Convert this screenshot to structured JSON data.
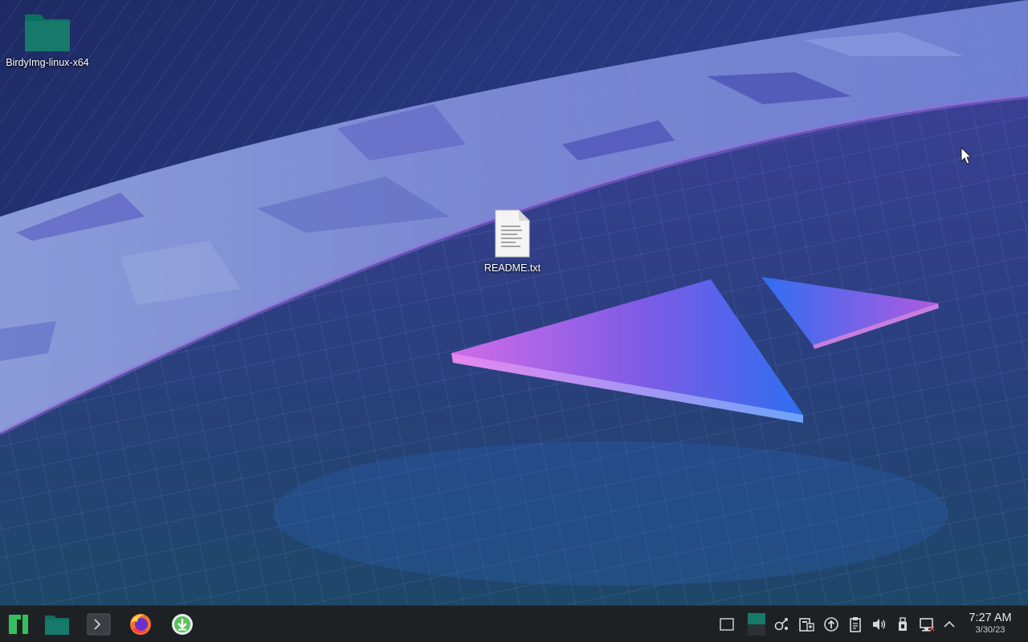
{
  "desktop": {
    "icons": [
      {
        "label": "BirdyImg-linux-x64",
        "icon": "folder-icon",
        "color": "#16796a"
      },
      {
        "label": "README.txt",
        "icon": "text-file-icon"
      }
    ]
  },
  "taskbar": {
    "launchers": [
      {
        "icon": "manjaro-menu-icon",
        "color": "#35bf5c"
      },
      {
        "icon": "file-manager-icon",
        "color": "#16796a"
      },
      {
        "icon": "terminal-icon"
      },
      {
        "icon": "firefox-icon"
      },
      {
        "icon": "software-install-icon",
        "color": "#5cc05c"
      }
    ],
    "tray": [
      "show-desktop-icon",
      "pager-icon",
      "kde-connect-icon",
      "clipboard-manager-icon",
      "updates-icon",
      "clipboard-icon",
      "volume-icon",
      "usb-device-icon",
      "network-icon",
      "expand-tray-icon"
    ],
    "clock": {
      "time": "7:27 AM",
      "date": "3/30/23"
    }
  }
}
